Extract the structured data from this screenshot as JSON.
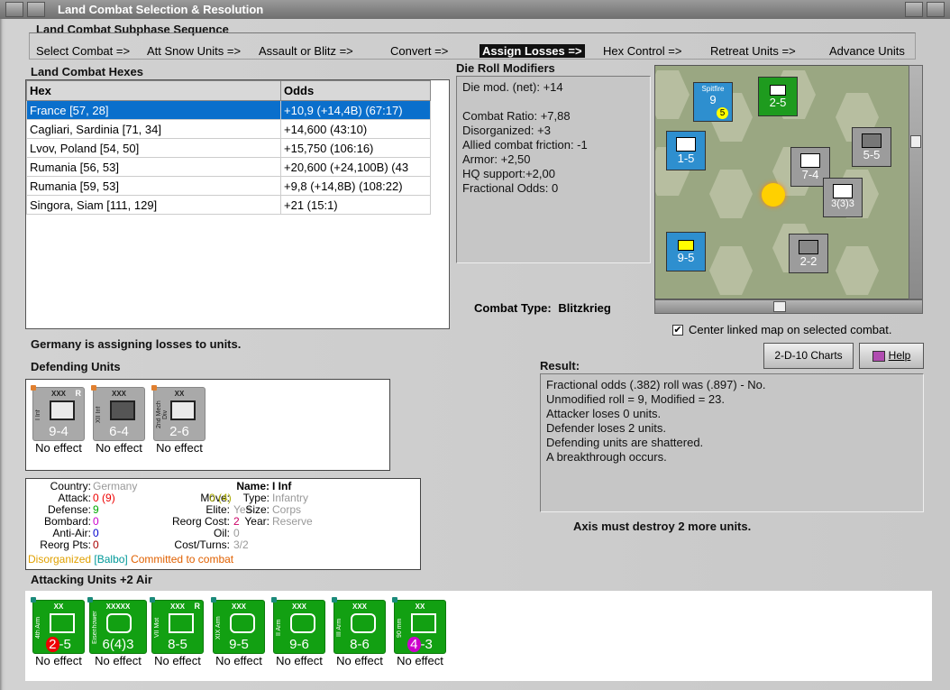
{
  "window": {
    "title": "Land Combat Selection & Resolution"
  },
  "sequence": {
    "heading": "Land Combat Subphase Sequence",
    "steps": [
      "Select Combat =>",
      "Att Snow Units =>",
      "Assault or Blitz =>",
      "Convert =>",
      "Assign Losses =>",
      "Hex Control =>",
      "Retreat Units =>",
      "Advance Units"
    ],
    "active_index": 4
  },
  "hexes": {
    "heading": "Land Combat Hexes",
    "columns": [
      "Hex",
      "Odds"
    ],
    "rows": [
      {
        "hex": "France [57, 28]",
        "odds": "+10,9 (+14,4B) (67:17)",
        "selected": true
      },
      {
        "hex": "Cagliari, Sardinia [71, 34]",
        "odds": "+14,600 (43:10)"
      },
      {
        "hex": "Lvov, Poland [54, 50]",
        "odds": "+15,750 (106:16)"
      },
      {
        "hex": "Rumania [56, 53]",
        "odds": "+20,600 (+24,100B) (43"
      },
      {
        "hex": "Rumania [59, 53]",
        "odds": "+9,8 (+14,8B) (108:22)"
      },
      {
        "hex": "Singora, Siam [111, 129]",
        "odds": "+21 (15:1)"
      }
    ]
  },
  "modifiers": {
    "heading": "Die Roll Modifiers",
    "lines": [
      "Die mod. (net): +14",
      "",
      "Combat Ratio: +7,88",
      "Disorganized: +3",
      "Allied combat friction: -1",
      "Armor: +2,50",
      "HQ support:+2,00",
      "Fractional Odds: 0"
    ]
  },
  "combat_type": {
    "label": "Combat Type:",
    "value": "Blitzkrieg"
  },
  "center_map": {
    "label": "Center linked map on selected combat.",
    "checked": true
  },
  "status_message": "Germany is assigning losses to units.",
  "buttons": {
    "charts": "2-D-10 Charts",
    "help": "Help"
  },
  "result": {
    "heading": "Result:",
    "lines": [
      "Fractional odds (.382) roll was (.897)  - No.",
      "Unmodified roll = 9, Modified = 23.",
      "Attacker loses 0 units.",
      "Defender loses 2 units.",
      "Defending units are shattered.",
      "A breakthrough occurs."
    ],
    "footer": "Axis must destroy 2 more units."
  },
  "defending": {
    "heading": "Defending Units",
    "units": [
      {
        "size": "XXX",
        "name": "I Inf",
        "strength": "9-4",
        "effect": "No effect",
        "reserve": "R"
      },
      {
        "size": "XXX",
        "name": "XII Inf",
        "strength": "6-4",
        "effect": "No effect",
        "reserve": ""
      },
      {
        "size": "XX",
        "name": "2nd Mech Div",
        "strength": "2-6",
        "effect": "No effect",
        "reserve": ""
      }
    ]
  },
  "details": {
    "country_label": "Country:",
    "country": "Germany",
    "attack_label": "Attack:",
    "attack": "0",
    "attack_alt": "(9)",
    "defense_label": "Defense:",
    "defense": "9",
    "bombard_label": "Bombard:",
    "bombard": "0",
    "antiair_label": "Anti-Air:",
    "antiair": "0",
    "reorgpts_label": "Reorg Pts:",
    "reorgpts": "0",
    "name_label": "Name:",
    "name": "I Inf",
    "move_label": "Move:",
    "move": "0",
    "move_alt": "(4)",
    "type_label": "Type:",
    "type": "Infantry",
    "elite_label": "Elite:",
    "elite": "Yes",
    "size_label": "Size:",
    "size": "Corps",
    "reorgcost_label": "Reorg Cost:",
    "reorgcost": "2",
    "year_label": "Year:",
    "year": "Reserve",
    "oil_label": "Oil:",
    "oil": "0",
    "cost_label": "Cost/Turns:",
    "cost": "3/2",
    "status_disorg": "Disorganized",
    "status_hq": "[Balbo]",
    "status_committed": "Committed to combat"
  },
  "attacking": {
    "heading": "Attacking Units +2 Air",
    "units": [
      {
        "size": "XX",
        "name": "4th Arm",
        "strength_a": "2",
        "strength_b": "-5",
        "effect": "No effect",
        "reserve": ""
      },
      {
        "size": "XXXXX",
        "name": "Eisenhower",
        "strength_a": "6(4)3",
        "strength_b": "",
        "effect": "No effect",
        "reserve": ""
      },
      {
        "size": "XXX",
        "name": "VII Mot",
        "strength_a": "8-5",
        "strength_b": "",
        "effect": "No effect",
        "reserve": "R"
      },
      {
        "size": "XXX",
        "name": "XIX Arm",
        "strength_a": "9-5",
        "strength_b": "",
        "effect": "No effect",
        "reserve": ""
      },
      {
        "size": "XXX",
        "name": "II Arm",
        "strength_a": "9-6",
        "strength_b": "",
        "effect": "No effect",
        "reserve": ""
      },
      {
        "size": "XXX",
        "name": "III Arm",
        "strength_a": "8-6",
        "strength_b": "",
        "effect": "No effect",
        "reserve": ""
      },
      {
        "size": "XX",
        "name": "90 mm",
        "strength_a": "4",
        "strength_b": "-3",
        "effect": "No effect",
        "reserve": ""
      }
    ]
  },
  "map": {
    "counters": [
      {
        "label": "9",
        "sub": "Spitfire",
        "val": "5"
      },
      {
        "label": "2-5",
        "sub": "",
        "val": ""
      },
      {
        "label": "7-4",
        "sub": "",
        "val": ""
      },
      {
        "label": "5-5",
        "sub": "",
        "val": ""
      },
      {
        "label": "1-5",
        "sub": "",
        "val": ""
      },
      {
        "label": "9-5",
        "sub": "",
        "val": ""
      },
      {
        "label": "2-2",
        "sub": "",
        "val": ""
      },
      {
        "label": "3(3)3",
        "sub": "",
        "val": ""
      }
    ]
  },
  "colors": {
    "selected_row": "#0a6fcc",
    "attacker": "#12a012",
    "defender": "#a9a9a9",
    "allied": "#2e8fcf"
  }
}
